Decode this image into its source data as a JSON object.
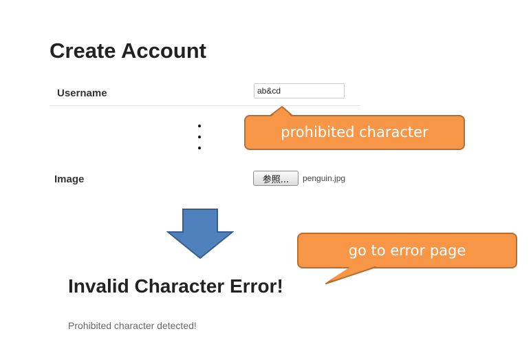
{
  "form": {
    "title": "Create Account",
    "username": {
      "label": "Username",
      "value": "ab&cd"
    },
    "image": {
      "label": "Image",
      "button_label": "参照...",
      "file_name": "penguin.jpg"
    }
  },
  "annotations": {
    "callout_prohibited": "prohibited character",
    "callout_error_page": "go to error page",
    "callout_color": "#f79646",
    "arrow_color": "#4f81bd"
  },
  "error_page": {
    "title": "Invalid Character Error!",
    "message": "Prohibited character detected!"
  }
}
